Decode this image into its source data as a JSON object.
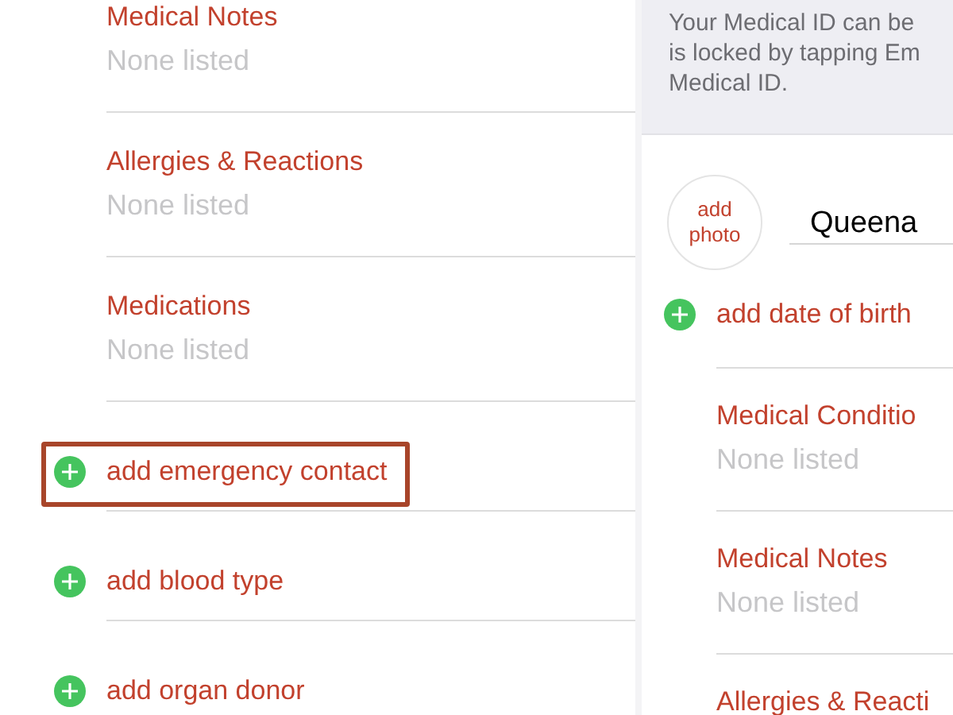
{
  "left_panel": {
    "sections": [
      {
        "kind": "field",
        "title": "Medical Notes",
        "value": "None listed"
      },
      {
        "kind": "field",
        "title": "Allergies & Reactions",
        "value": "None listed"
      },
      {
        "kind": "field",
        "title": "Medications",
        "value": "None listed"
      },
      {
        "kind": "add",
        "label": "add emergency contact",
        "highlighted": true
      },
      {
        "kind": "add",
        "label": "add blood type",
        "highlighted": false
      },
      {
        "kind": "add",
        "label": "add organ donor",
        "highlighted": false
      }
    ]
  },
  "right_panel": {
    "info_text": "Your Medical ID can be\nis locked by tapping Em\nMedical ID.",
    "photo_button": "add\nphoto",
    "name": "Queena",
    "sections": [
      {
        "kind": "add",
        "label": "add date of birth",
        "highlighted": false
      },
      {
        "kind": "field",
        "title": "Medical Conditio",
        "value": "None listed"
      },
      {
        "kind": "field",
        "title": "Medical Notes",
        "value": "None listed"
      },
      {
        "kind": "field",
        "title": "Allergies & Reacti"
      }
    ]
  }
}
